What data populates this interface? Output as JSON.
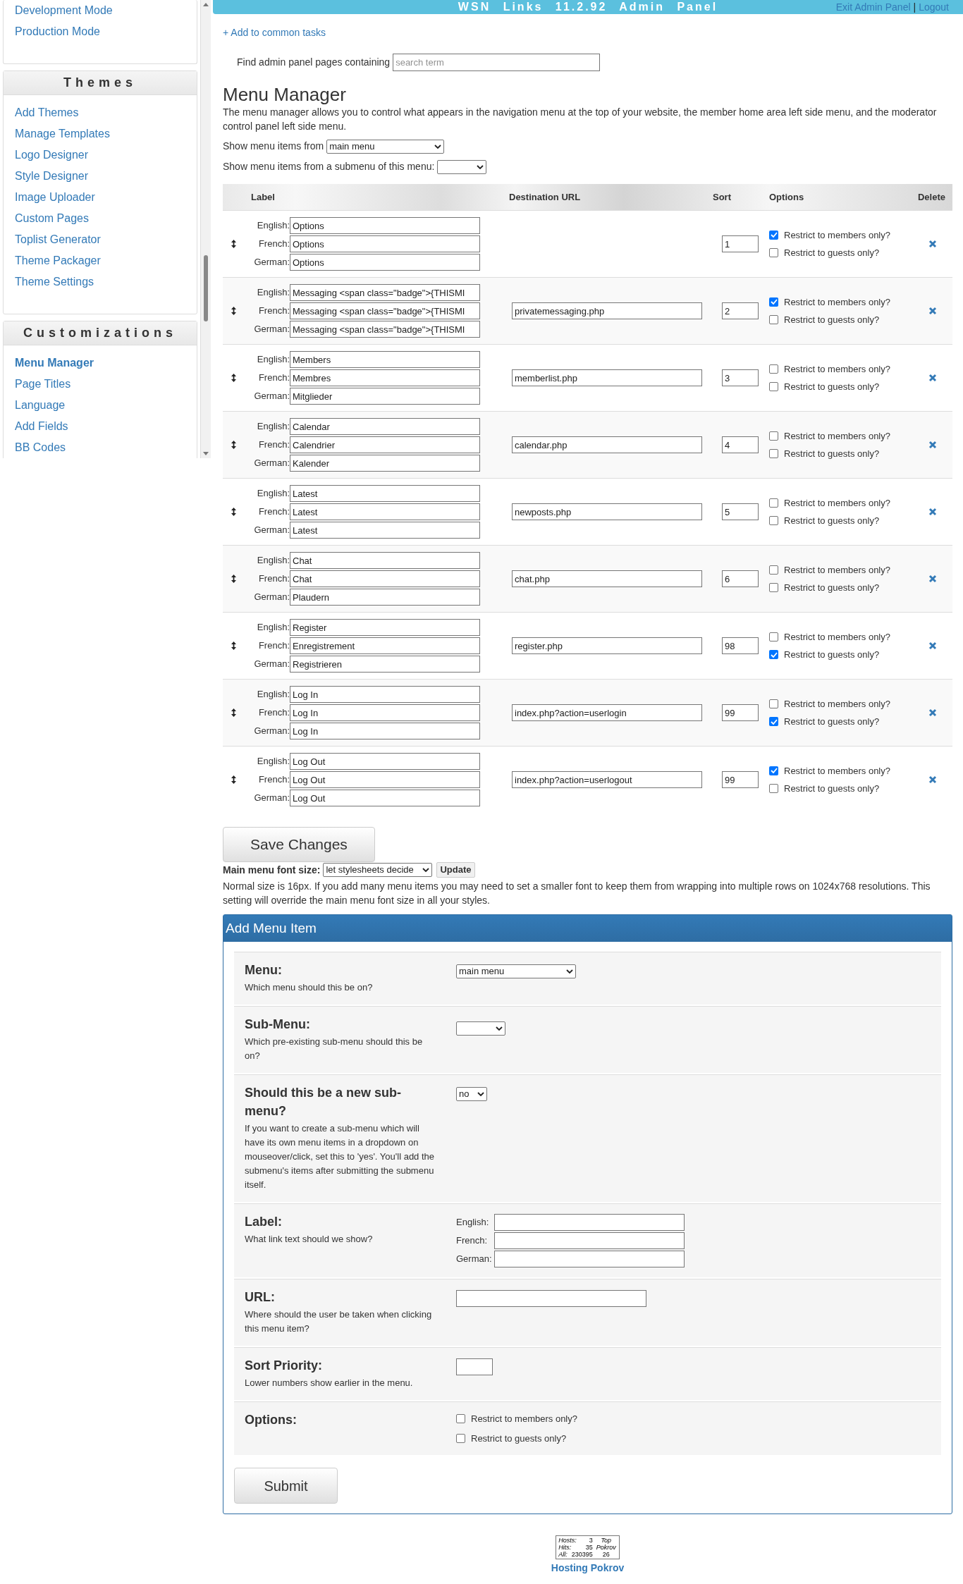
{
  "sidebar": {
    "sections": [
      {
        "items": [
          {
            "label": "Development Mode",
            "selected": false
          },
          {
            "label": "Production Mode",
            "selected": false
          }
        ]
      },
      {
        "title": "Themes",
        "items": [
          {
            "label": "Add Themes",
            "selected": false
          },
          {
            "label": "Manage Templates",
            "selected": false
          },
          {
            "label": "Logo Designer",
            "selected": false
          },
          {
            "label": "Style Designer",
            "selected": false
          },
          {
            "label": "Image Uploader",
            "selected": false
          },
          {
            "label": "Custom Pages",
            "selected": false
          },
          {
            "label": "Toplist Generator",
            "selected": false
          },
          {
            "label": "Theme Packager",
            "selected": false
          },
          {
            "label": "Theme Settings",
            "selected": false
          }
        ]
      },
      {
        "title": "Customizations",
        "items": [
          {
            "label": "Menu Manager",
            "selected": true
          },
          {
            "label": "Page Titles",
            "selected": false
          },
          {
            "label": "Language",
            "selected": false
          },
          {
            "label": "Add Fields",
            "selected": false
          },
          {
            "label": "BB Codes",
            "selected": false
          }
        ]
      }
    ]
  },
  "header": {
    "title": "WSN Links 11.2.92 Admin Panel",
    "links": [
      "Exit Admin Panel",
      "Logout"
    ],
    "separator": "|"
  },
  "common_tasks_link": "+ Add to common tasks",
  "search": {
    "label": "Find admin panel pages containing",
    "placeholder": "search term"
  },
  "page_title": "Menu Manager",
  "description": "The menu manager allows you to control what appears in the navigation menu at the top of your website, the member home area left side menu, and the moderator control panel left side menu.",
  "filters": [
    {
      "label": "Show menu items from",
      "value": "main menu"
    },
    {
      "label": "Show menu items from a submenu of this menu:"
    }
  ],
  "table": {
    "columns": [
      "Label",
      "Destination URL",
      "Sort",
      "Options",
      "Delete"
    ],
    "rows": [
      {
        "language_labels": [
          "English:",
          "French:",
          "German:"
        ],
        "labels": [
          "Options",
          "Options",
          "Options"
        ],
        "sort": "1",
        "members": true,
        "members_label": "Restrict to members only?",
        "guests": false,
        "guests_label": "Restrict to guests only?"
      },
      {
        "language_labels": [
          "English:",
          "French:",
          "German:"
        ],
        "labels": [
          "Messaging <span class=\"badge\">{THISMI",
          "Messaging <span class=\"badge\">{THISMI",
          "Messaging <span class=\"badge\">{THISMI"
        ],
        "url": "privatemessaging.php",
        "sort": "2",
        "members": true,
        "members_label": "Restrict to members only?",
        "guests": false,
        "guests_label": "Restrict to guests only?"
      },
      {
        "language_labels": [
          "English:",
          "French:",
          "German:"
        ],
        "labels": [
          "Members",
          "Membres",
          "Mitglieder"
        ],
        "url": "memberlist.php",
        "sort": "3",
        "members": false,
        "members_label": "Restrict to members only?",
        "guests": false,
        "guests_label": "Restrict to guests only?"
      },
      {
        "language_labels": [
          "English:",
          "French:",
          "German:"
        ],
        "labels": [
          "Calendar",
          "Calendrier",
          "Kalender"
        ],
        "url": "calendar.php",
        "sort": "4",
        "members": false,
        "members_label": "Restrict to members only?",
        "guests": false,
        "guests_label": "Restrict to guests only?"
      },
      {
        "language_labels": [
          "English:",
          "French:",
          "German:"
        ],
        "labels": [
          "Latest",
          "Latest",
          "Latest"
        ],
        "url": "newposts.php",
        "sort": "5",
        "members": false,
        "members_label": "Restrict to members only?",
        "guests": false,
        "guests_label": "Restrict to guests only?"
      },
      {
        "language_labels": [
          "English:",
          "French:",
          "German:"
        ],
        "labels": [
          "Chat",
          "Chat",
          "Plaudern"
        ],
        "url": "chat.php",
        "sort": "6",
        "members": false,
        "members_label": "Restrict to members only?",
        "guests": false,
        "guests_label": "Restrict to guests only?"
      },
      {
        "language_labels": [
          "English:",
          "French:",
          "German:"
        ],
        "labels": [
          "Register",
          "Enregistrement",
          "Registrieren"
        ],
        "url": "register.php",
        "sort": "98",
        "members": false,
        "members_label": "Restrict to members only?",
        "guests": true,
        "guests_label": "Restrict to guests only?"
      },
      {
        "language_labels": [
          "English:",
          "French:",
          "German:"
        ],
        "labels": [
          "Log In",
          "Log In",
          "Log In"
        ],
        "url": "index.php?action=userlogin",
        "sort": "99",
        "members": false,
        "members_label": "Restrict to members only?",
        "guests": true,
        "guests_label": "Restrict to guests only?"
      },
      {
        "language_labels": [
          "English:",
          "French:",
          "German:"
        ],
        "labels": [
          "Log Out",
          "Log Out",
          "Log Out"
        ],
        "url": "index.php?action=userlogout",
        "sort": "99",
        "members": true,
        "members_label": "Restrict to members only?",
        "guests": false,
        "guests_label": "Restrict to guests only?"
      }
    ]
  },
  "save_button": "Save Changes",
  "font_size": {
    "label": "Main menu font size:",
    "value": "let stylesheets decide",
    "button": "Update",
    "note": "Normal size is 16px. If you add many menu items you may need to set a smaller font to keep them from wrapping into multiple rows on 1024x768 resolutions. This setting will override the main menu font size in all your styles."
  },
  "add_form": {
    "title": "Add Menu Item",
    "fields": [
      {
        "kind": "select",
        "title": "Menu:",
        "help": "Which menu should this be on?",
        "value": "main menu"
      },
      {
        "kind": "select",
        "title": "Sub-Menu:",
        "help": "Which pre-existing sub-menu should this be on?"
      },
      {
        "kind": "small_select",
        "title": "Should this be a new sub-menu?",
        "help": "If you want to create a sub-menu which will have its own menu items in a dropdown on mouseover/click, set this to 'yes'. You'll add the submenu's items after submitting the submenu itself.",
        "value": "no"
      },
      {
        "kind": "labels",
        "title": "Label:",
        "help": "What link text should we show?",
        "labels": [
          "English:",
          "French:",
          "German:"
        ]
      },
      {
        "kind": "text",
        "title": "URL:",
        "help": "Where should the user be taken when clicking this menu item?"
      },
      {
        "kind": "short_text",
        "title": "Sort Priority:",
        "help": "Lower numbers show earlier in the menu."
      },
      {
        "kind": "checkboxes",
        "title": "Options:",
        "options": [
          {
            "label": "Restrict to members only?",
            "checked": false
          },
          {
            "label": "Restrict to guests only?",
            "checked": false
          }
        ]
      }
    ],
    "submit": "Submit"
  },
  "footer": {
    "counter": {
      "rows": [
        [
          "Hosts:",
          "3"
        ],
        [
          "Hits:",
          "35"
        ],
        [
          "All:",
          "230395"
        ]
      ],
      "top_label": "Top Pokrov",
      "top_value": "26"
    },
    "link": "Hosting Pokrov"
  }
}
